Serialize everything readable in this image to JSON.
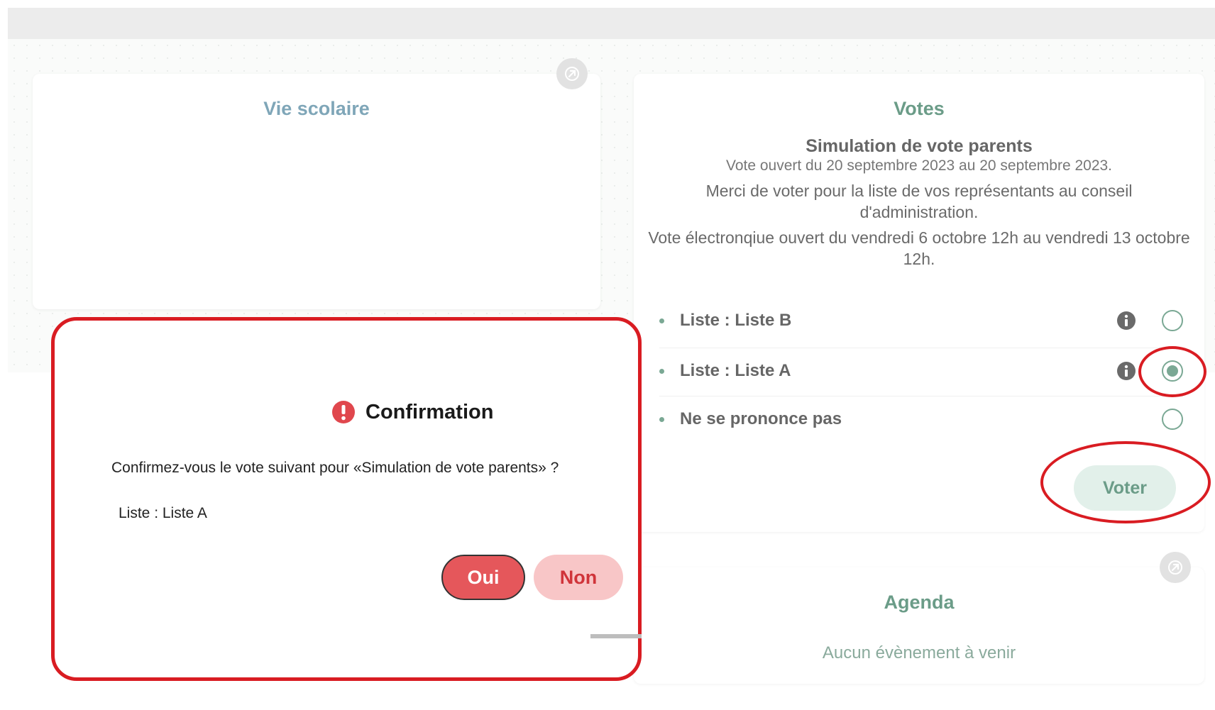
{
  "vie_scolaire": {
    "title": "Vie scolaire"
  },
  "votes": {
    "title": "Votes",
    "vote_name": "Simulation de vote parents",
    "vote_dates": "Vote ouvert du 20 septembre 2023 au 20 septembre 2023.",
    "message_1": "Merci de voter pour la liste de vos représentants au conseil d'administration.",
    "message_2": "Vote électronqiue ouvert du vendredi 6 octobre 12h au vendredi 13 octobre 12h.",
    "options": [
      {
        "label": "Liste : Liste B",
        "selected": false,
        "has_info": true
      },
      {
        "label": "Liste : Liste A",
        "selected": true,
        "has_info": true
      },
      {
        "label": "Ne se prononce pas",
        "selected": false,
        "has_info": false
      }
    ],
    "vote_button": "Voter"
  },
  "modal": {
    "title": "Confirmation",
    "question": "Confirmez-vous le vote suivant pour «Simulation de vote parents» ?",
    "choice": "Liste : Liste A",
    "yes_button": "Oui",
    "no_button": "Non"
  },
  "agenda": {
    "title": "Agenda",
    "empty_message": "Aucun évènement à venir"
  },
  "colors": {
    "accent": "#6b9c88",
    "annotation": "#d91c22",
    "confirm": "#e5575b",
    "cancel_bg": "#f8c6c7"
  }
}
